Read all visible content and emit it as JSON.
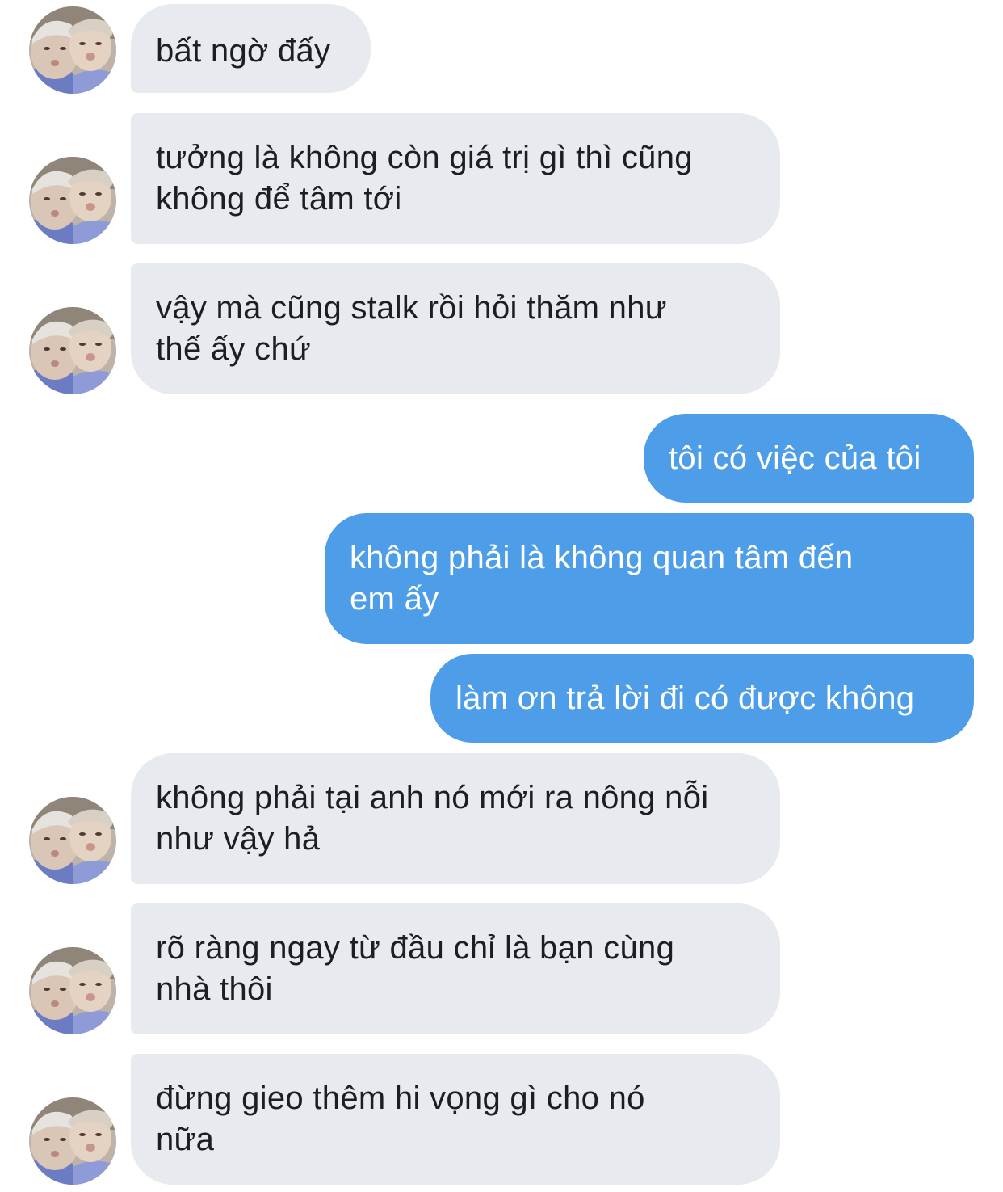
{
  "conversation": {
    "messages": [
      {
        "side": "received",
        "lines": [
          "bất ngờ đấy"
        ]
      },
      {
        "side": "received",
        "lines": [
          "tưởng là không còn giá trị gì thì cũng",
          "không để tâm tới"
        ]
      },
      {
        "side": "received",
        "lines": [
          "vậy mà cũng stalk rồi hỏi thăm như",
          "thế ấy chứ"
        ]
      },
      {
        "side": "sent",
        "lines": [
          "tôi có việc của tôi"
        ]
      },
      {
        "side": "sent",
        "lines": [
          "không phải là không quan tâm đến",
          "em ấy"
        ]
      },
      {
        "side": "sent",
        "lines": [
          "làm ơn trả lời đi có được không"
        ]
      },
      {
        "side": "received",
        "lines": [
          "không phải tại anh nó mới ra nông nỗi",
          "như vậy hả"
        ]
      },
      {
        "side": "received",
        "lines": [
          "rõ ràng ngay từ đầu chỉ là bạn cùng",
          "nhà thôi"
        ]
      },
      {
        "side": "received",
        "lines": [
          "đừng gieo thêm hi vọng gì cho nó",
          "nữa"
        ]
      }
    ]
  },
  "colors": {
    "received_bubble": "#e7eaee",
    "sent_bubble": "#4e9de8",
    "received_text": "#1c1e21",
    "sent_text": "#ffffff"
  },
  "icons": {
    "avatar": "contact-avatar-photo"
  }
}
